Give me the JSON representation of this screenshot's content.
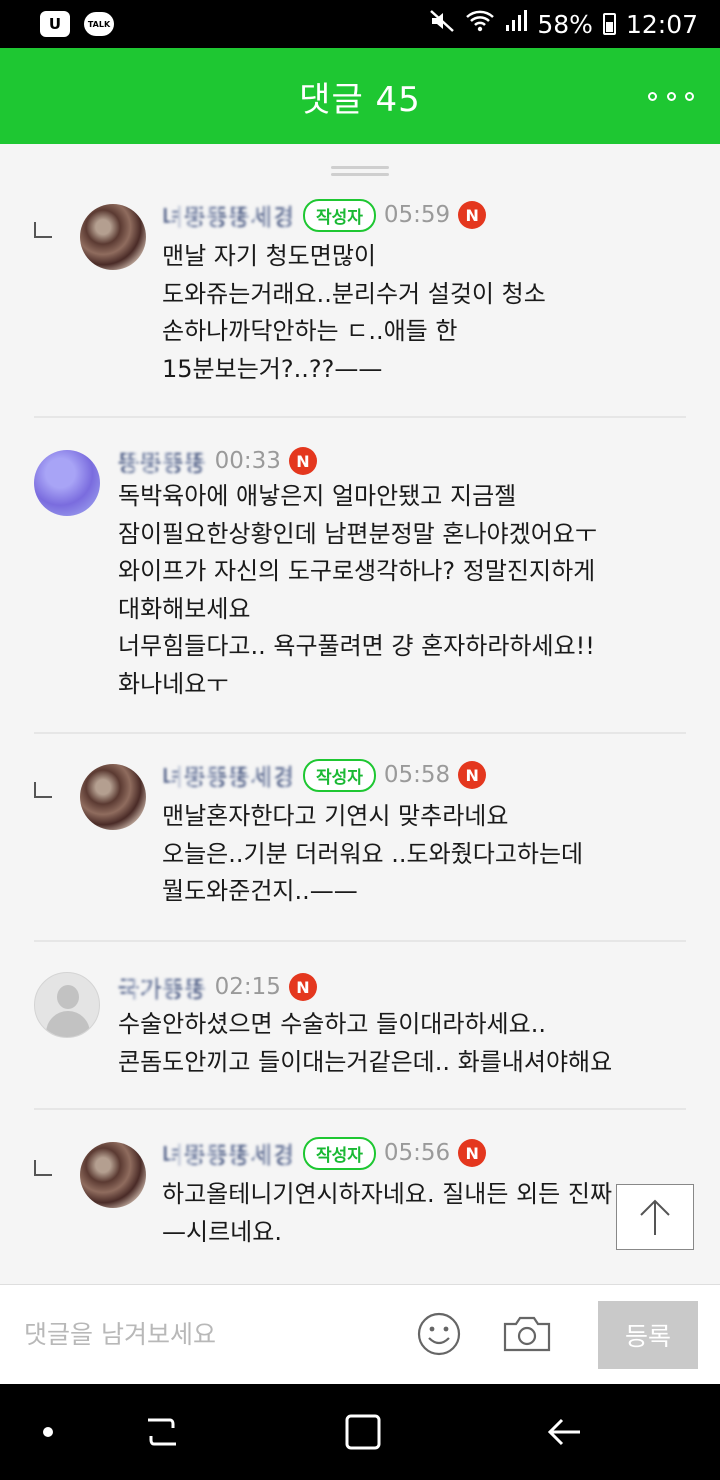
{
  "status_bar": {
    "left_icons": [
      "U",
      "TALK"
    ],
    "battery": "58%",
    "time": "12:07"
  },
  "header": {
    "title": "댓글 45",
    "more_icon": "more-dots-icon"
  },
  "comments": [
    {
      "is_reply": true,
      "nickname": "녀뚱뚱뚱세경",
      "author_badge": "작성자",
      "time": "05:59",
      "new_badge": "N",
      "text": "맨날 자기 청도면많이\n도와쥬는거래요..분리수거 설겆이 청소\n손하나까닥안하는 ㄷ..애들 한\n15분보는거?..??——"
    },
    {
      "is_reply": false,
      "nickname": "뚱뚱뚱뚱",
      "time": "00:33",
      "new_badge": "N",
      "text": "독박육아에 애낳은지 얼마안됐고 지금젤\n잠이필요한상황인데 남편분정말 혼나야겠어요ㅜ\n와이프가 자신의 도구로생각하나? 정말진지하게\n대화해보세요\n너무힘들다고.. 욕구풀려면 걍 혼자하라하세요!!\n화나네요ㅜ"
    },
    {
      "is_reply": true,
      "nickname": "녀뚱뚱뚱세경",
      "author_badge": "작성자",
      "time": "05:58",
      "new_badge": "N",
      "text": "맨날혼자한다고 기연시 맞추라네요\n오늘은..기분 더러워요 ..도와줬다고하는데\n뭘도와준건지..——"
    },
    {
      "is_reply": false,
      "nickname": "국가뚱뚱",
      "time": "02:15",
      "new_badge": "N",
      "text": "수술안하셨으면 수술하고 들이대라하세요..\n콘돔도안끼고 들이대는거같은데.. 화를내셔야해요"
    },
    {
      "is_reply": true,
      "nickname": "녀뚱뚱뚱세경",
      "author_badge": "작성자",
      "time": "05:56",
      "new_badge": "N",
      "text": "하고올테니기연시하자네요. 질내든 외든 진짜\n—시르네요."
    }
  ],
  "input_bar": {
    "placeholder": "댓글을 남겨보세요",
    "submit_label": "등록"
  },
  "colors": {
    "brand_green": "#1ec732",
    "new_badge_red": "#e4371e"
  }
}
